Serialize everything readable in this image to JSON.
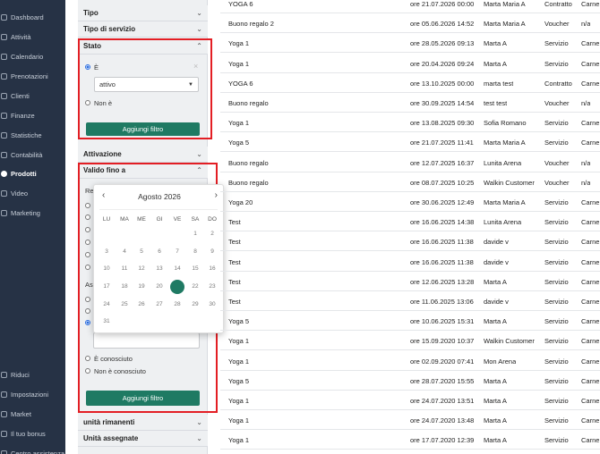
{
  "sidebar": {
    "items": [
      {
        "label": "Dashboard",
        "icon": "dashboard-icon"
      },
      {
        "label": "Attività",
        "icon": "activity-icon"
      },
      {
        "label": "Calendario",
        "icon": "calendar-icon"
      },
      {
        "label": "Prenotazioni",
        "icon": "bookings-icon"
      },
      {
        "label": "Clienti",
        "icon": "clients-icon"
      },
      {
        "label": "Finanze",
        "icon": "finance-icon"
      },
      {
        "label": "Statistiche",
        "icon": "stats-icon"
      },
      {
        "label": "Contabilità",
        "icon": "accounting-icon"
      },
      {
        "label": "Prodotti",
        "icon": "products-icon"
      },
      {
        "label": "Video",
        "icon": "video-icon"
      },
      {
        "label": "Marketing",
        "icon": "marketing-icon"
      }
    ],
    "bottom_items": [
      {
        "label": "Riduci",
        "icon": "collapse-icon"
      },
      {
        "label": "Impostazioni",
        "icon": "settings-icon"
      },
      {
        "label": "Market",
        "icon": "market-icon"
      },
      {
        "label": "Il tuo bonus",
        "icon": "bonus-icon"
      },
      {
        "label": "Centro assistenza",
        "icon": "help-icon"
      }
    ]
  },
  "filters": {
    "tipo": "Tipo",
    "tipo_servizio": "Tipo di servizio",
    "stato": {
      "title": "Stato",
      "option_is": "È",
      "selected_value": "attivo",
      "option_not": "Non è",
      "clear": "×",
      "button": "Aggiungi filtro"
    },
    "attivazione": "Attivazione",
    "valido": {
      "title": "Valido fino a",
      "partial_1": "Re",
      "partial_2": "As",
      "unknown": "È conosciuto",
      "not_unknown": "Non è conosciuto",
      "button": "Aggiungi filtro"
    },
    "unita_rimanenti": "unità rimanenti",
    "unita_assegnate": "Unità assegnate"
  },
  "datepicker": {
    "title": "Agosto 2026",
    "weekdays": [
      "LU",
      "MA",
      "ME",
      "GI",
      "VE",
      "SA",
      "DO"
    ],
    "days": [
      1,
      2,
      3,
      4,
      5,
      6,
      7,
      8,
      9,
      10,
      11,
      12,
      13,
      14,
      15,
      16,
      17,
      18,
      19,
      20,
      21,
      22,
      23,
      24,
      25,
      26,
      27,
      28,
      29,
      30,
      31
    ],
    "selected_day": 21,
    "accent": "#1f7a63"
  },
  "table": {
    "rows": [
      {
        "name": "YOGA 6",
        "date": "ore 21.07.2026 00:00",
        "client": "Marta Maria A",
        "type": "Contratto",
        "extra": "Carne"
      },
      {
        "name": "Buono regalo 2",
        "date": "ore 05.06.2026 14:52",
        "client": "Marta Maria A",
        "type": "Voucher",
        "extra": "n/a"
      },
      {
        "name": "Yoga 1",
        "date": "ore 28.05.2026 09:13",
        "client": "Marta A",
        "type": "Servizio",
        "extra": "Carne"
      },
      {
        "name": "Yoga 1",
        "date": "ore 20.04.2026 09:24",
        "client": "Marta A",
        "type": "Servizio",
        "extra": "Carne"
      },
      {
        "name": "YOGA 6",
        "date": "ore 13.10.2025 00:00",
        "client": "marta test",
        "type": "Contratto",
        "extra": "Carne"
      },
      {
        "name": "Buono regalo",
        "date": "ore 30.09.2025 14:54",
        "client": "test test",
        "type": "Voucher",
        "extra": "n/a"
      },
      {
        "name": "Yoga 1",
        "date": "ore 13.08.2025 09:30",
        "client": "Sofia Romano",
        "type": "Servizio",
        "extra": "Carne"
      },
      {
        "name": "Yoga 5",
        "date": "ore 21.07.2025 11:41",
        "client": "Marta Maria A",
        "type": "Servizio",
        "extra": "Carne"
      },
      {
        "name": "Buono regalo",
        "date": "ore 12.07.2025 16:37",
        "client": "Lunita Arena",
        "type": "Voucher",
        "extra": "n/a"
      },
      {
        "name": "Buono regalo",
        "date": "ore 08.07.2025 10:25",
        "client": "Walkin Customer",
        "type": "Voucher",
        "extra": "n/a"
      },
      {
        "name": "Yoga 20",
        "date": "ore 30.06.2025 12:49",
        "client": "Marta Maria A",
        "type": "Servizio",
        "extra": "Carne"
      },
      {
        "name": "Test",
        "date": "ore 16.06.2025 14:38",
        "client": "Lunita Arena",
        "type": "Servizio",
        "extra": "Carne"
      },
      {
        "name": "Test",
        "date": "ore 16.06.2025 11:38",
        "client": "davide v",
        "type": "Servizio",
        "extra": "Carne"
      },
      {
        "name": "Test",
        "date": "ore 16.06.2025 11:38",
        "client": "davide v",
        "type": "Servizio",
        "extra": "Carne"
      },
      {
        "name": "Test",
        "date": "ore 12.06.2025 13:28",
        "client": "Marta A",
        "type": "Servizio",
        "extra": "Carne"
      },
      {
        "name": "Test",
        "date": "ore 11.06.2025 13:06",
        "client": "davide v",
        "type": "Servizio",
        "extra": "Carne"
      },
      {
        "name": "Yoga 5",
        "date": "ore 10.06.2025 15:31",
        "client": "Marta A",
        "type": "Servizio",
        "extra": "Carne"
      },
      {
        "name": "Yoga 1",
        "date": "ore 15.09.2020 10:37",
        "client": "Walkin Customer",
        "type": "Servizio",
        "extra": "Carne"
      },
      {
        "name": "Yoga 1",
        "date": "ore 02.09.2020 07:41",
        "client": "Mon Arena",
        "type": "Servizio",
        "extra": "Carne"
      },
      {
        "name": "Yoga 5",
        "date": "ore 28.07.2020 15:55",
        "client": "Marta A",
        "type": "Servizio",
        "extra": "Carne"
      },
      {
        "name": "Yoga 1",
        "date": "ore 24.07.2020 13:51",
        "client": "Marta A",
        "type": "Servizio",
        "extra": "Carne"
      },
      {
        "name": "Yoga 1",
        "date": "ore 24.07.2020 13:48",
        "client": "Marta A",
        "type": "Servizio",
        "extra": "Carne"
      },
      {
        "name": "Yoga 1",
        "date": "ore 17.07.2020 12:39",
        "client": "Marta A",
        "type": "Servizio",
        "extra": "Carne"
      }
    ]
  }
}
